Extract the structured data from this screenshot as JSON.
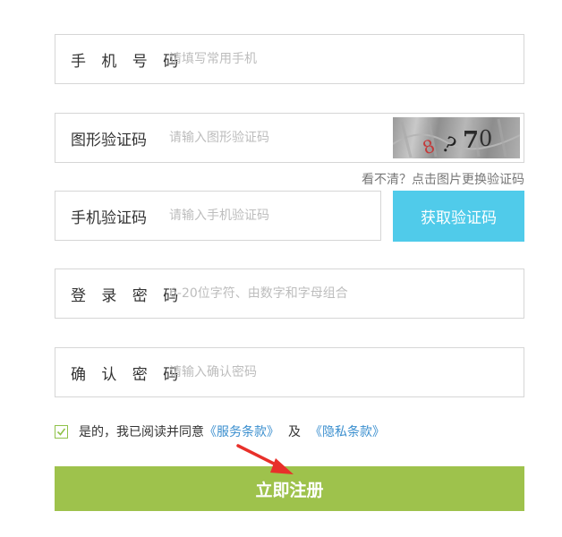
{
  "form": {
    "phone": {
      "label": "手 机 号 码",
      "placeholder": "请填写常用手机",
      "value": ""
    },
    "captcha": {
      "label": "图形验证码",
      "placeholder": "请输入图形验证码",
      "value": "",
      "image_text": "8 ?70"
    },
    "refresh_hint": "看不清？点击图片更换验证码",
    "sms_code": {
      "label": "手机验证码",
      "placeholder": "请输入手机验证码",
      "value": ""
    },
    "sms_button": "获取验证码",
    "password": {
      "label": "登 录 密 码",
      "placeholder": "6-20位字符、由数字和字母组合",
      "value": ""
    },
    "password_confirm": {
      "label": "确 认 密 码",
      "placeholder": "请输入确认密码",
      "value": ""
    }
  },
  "agreement": {
    "checked": true,
    "prefix": "是的，我已阅读并同意",
    "terms_link": "《服务条款》",
    "conjunction": "及",
    "privacy_link": "《隐私条款》"
  },
  "submit_label": "立即注册",
  "colors": {
    "sms_button_bg": "#50cbea",
    "submit_bg": "#9ec24c",
    "link": "#3b8fcf",
    "checkbox_check": "#8fc24a",
    "annotation_arrow": "#e8302a"
  },
  "icons": {
    "checkbox": "checkmark-icon",
    "annotation": "red-arrow-icon"
  }
}
